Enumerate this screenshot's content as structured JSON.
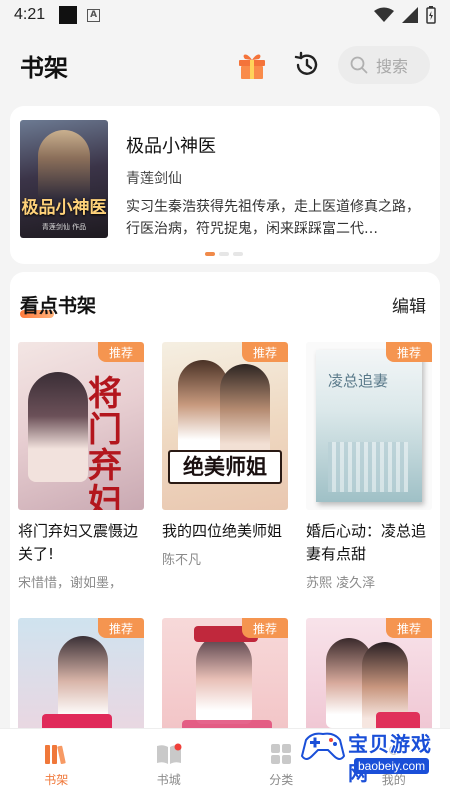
{
  "status_bar": {
    "time": "4:21"
  },
  "header": {
    "title": "书架",
    "search_placeholder": "搜索"
  },
  "featured": {
    "cover_title": "极品小神医",
    "cover_sub": "青莲剑仙 作品",
    "title": "极品小神医",
    "author": "青莲剑仙",
    "description": "实习生秦浩获得先祖传承，走上医道修真之路，行医治病，符咒捉鬼，闲来踩踩富二代…"
  },
  "shelf": {
    "title": "看点书架",
    "edit_label": "编辑",
    "badge": "推荐",
    "books": [
      {
        "title": "将门弃妇又震慑边关了!",
        "author": "宋惜惜，谢如墨，"
      },
      {
        "title": "我的四位绝美师姐",
        "author": "陈不凡"
      },
      {
        "title": "婚后心动：凌总追妻有点甜",
        "author": "苏熙  凌久泽"
      },
      {
        "title": "",
        "author": ""
      },
      {
        "title": "",
        "author": ""
      },
      {
        "title": "",
        "author": ""
      }
    ]
  },
  "bottom_nav": {
    "items": [
      {
        "label": "书架",
        "active": true
      },
      {
        "label": "书城",
        "active": false
      },
      {
        "label": "分类",
        "active": false
      },
      {
        "label": "我的",
        "active": false
      }
    ]
  },
  "watermark": {
    "text": "宝贝游戏网",
    "url": "baobeiy.com"
  },
  "colors": {
    "accent": "#f0783a",
    "badge": "#f59550"
  }
}
